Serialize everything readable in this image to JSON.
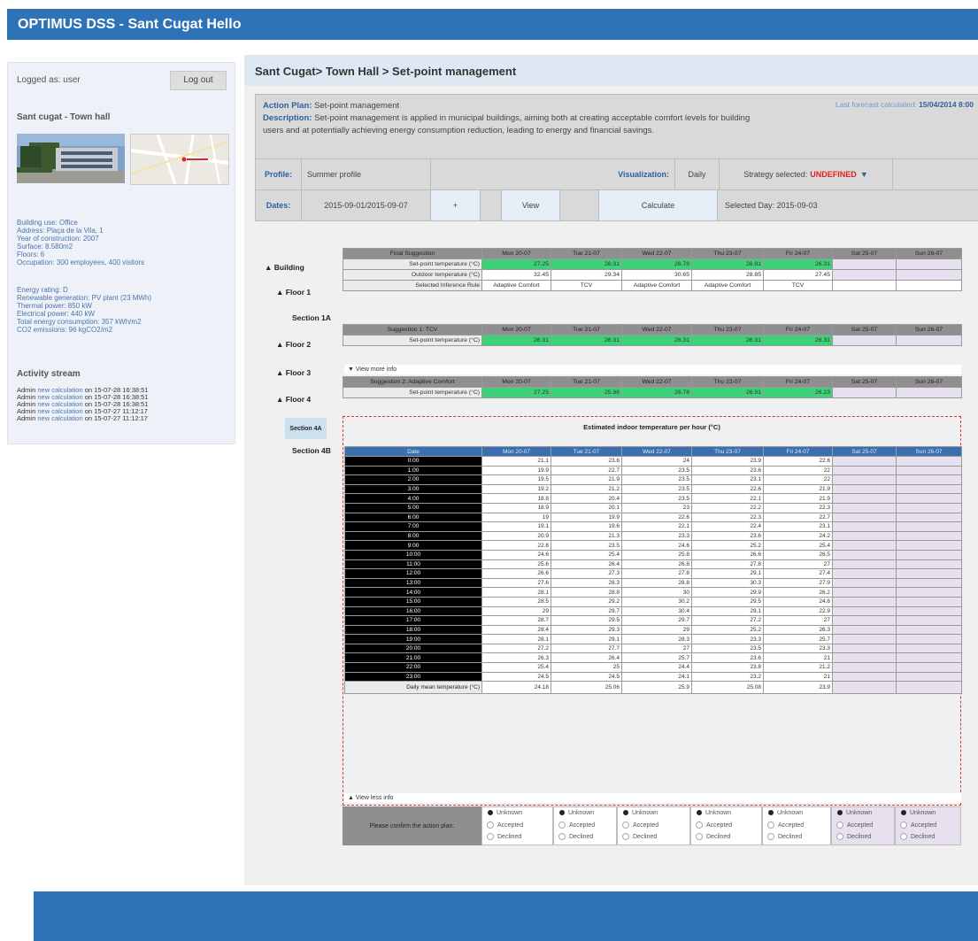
{
  "app": {
    "title": "OPTIMUS DSS - Sant Cugat Hello"
  },
  "sidebar": {
    "logged_as": "Logged as: user",
    "logout_label": "Log out",
    "building_name": "Sant cugat - Town hall",
    "info_lines": [
      "Building use: Office",
      "Address: Plaça de la Vila, 1",
      "Year of construction: 2007",
      "Surface: 8.580m2",
      "Floors: 6",
      "Occupation: 300 employees, 400 visitors"
    ],
    "energy_lines": [
      "Energy rating: D",
      "Renewable generation: PV plant (23 MWh)",
      "Thermal power: 850 kW",
      "Electrical power: 440 kW",
      "Total energy consumption: 357 kWh/m2",
      "CO2 emissions: 96 kgCO2/m2"
    ],
    "activity_title": "Activity stream",
    "activity": [
      {
        "user": "Admin",
        "link": "new calculation",
        "on": "on",
        "ts": "15-07-28 16:38:51"
      },
      {
        "user": "Admin",
        "link": "new calculation",
        "on": "on",
        "ts": "15-07-28 16:38:51"
      },
      {
        "user": "Admin",
        "link": "new calculation",
        "on": "on",
        "ts": "15-07-28 16:38:51"
      },
      {
        "user": "Admin",
        "link": "new calculation",
        "on": "on",
        "ts": "15-07-27 11:12:17"
      },
      {
        "user": "Admin",
        "link": "new calculation",
        "on": "on",
        "ts": "15-07-27 11:12:17"
      }
    ]
  },
  "main": {
    "breadcrumb": "Sant Cugat> Town Hall > Set-point management",
    "action_plan_label": "Action Plan:",
    "action_plan_value": "Set-point management",
    "description_label": "Description:",
    "description_text": "Set-point management is applied in municipal buildings, aiming both at creating acceptable comfort levels for building users and at potentially achieving energy consumption reduction, leading to energy and financial savings.",
    "forecast_label": "Last forecast calculated:",
    "forecast_value": "15/04/2014 8:00",
    "profile_label": "Profile:",
    "profile_value": "Summer profile",
    "visualization_label": "Visualization:",
    "visualization_value": "Daily",
    "strategy_label": "Strategy selected:",
    "strategy_value": "UNDEFINED",
    "dates_label": "Dates:",
    "dates_value": "2015-09-01/2015-09-07",
    "plus_label": "+",
    "view_label": "View",
    "calculate_label": "Calculate",
    "selected_day": "Selected Day: 2015-09-03"
  },
  "tree": {
    "building": "Building",
    "floor1": "Floor 1",
    "section1a": "Section 1A",
    "floor2": "Floor 2",
    "floor3": "Floor 3",
    "floor4": "Floor 4",
    "section4a": "Section 4A",
    "section4b": "Section 4B"
  },
  "days": [
    "Mon 20-07",
    "Tue 21-07",
    "Wed 22-07",
    "Thu 23-07",
    "Fri 24-07",
    "Sat 25-07",
    "Sun 26-07"
  ],
  "final": {
    "caption": "Final Suggestion",
    "rows": [
      {
        "label": "Set-point temperature (°C)",
        "values": [
          "27.25",
          "26.31",
          "26.78",
          "26.91",
          "26.31",
          "",
          ""
        ],
        "style": "grn"
      },
      {
        "label": "Outdoor temperature (°C)",
        "values": [
          "32.45",
          "29.34",
          "30.65",
          "28.85",
          "27.45",
          "",
          ""
        ],
        "style": "wht"
      },
      {
        "label": "Selected Inference Rule",
        "values": [
          "Adaptive Comfort",
          "TCV",
          "Adaptive Comfort",
          "Adaptive Comfort",
          "TCV",
          "",
          ""
        ],
        "style": "rule"
      }
    ]
  },
  "sugg1": {
    "caption": "Suggestion 1: TCV",
    "rows": [
      {
        "label": "Set-point temperature (°C)",
        "values": [
          "26.31",
          "26.31",
          "26.31",
          "26.31",
          "26.31",
          "",
          ""
        ],
        "style": "grn"
      }
    ]
  },
  "view_more": "View more info",
  "sugg2": {
    "caption": "Suggestion 2: Adaptive Comfort",
    "rows": [
      {
        "label": "Set-point temperature (°C)",
        "values": [
          "27.25",
          "25.96",
          "26.78",
          "26.91",
          "26.23",
          "",
          ""
        ],
        "style": "grn"
      }
    ]
  },
  "hourly": {
    "title": "Estimated indoor temperature per hour (°C)",
    "date_header": "Date",
    "hours": [
      "0:00",
      "1:00",
      "2:00",
      "3:00",
      "4:00",
      "5:00",
      "6:00",
      "7:00",
      "8:00",
      "9:00",
      "10:00",
      "11:00",
      "12:00",
      "13:00",
      "14:00",
      "15:00",
      "16:00",
      "17:00",
      "18:00",
      "19:00",
      "20:00",
      "21:00",
      "22:00",
      "23:00"
    ],
    "values": [
      [
        "21.1",
        "23.6",
        "24",
        "23.9",
        "22.6"
      ],
      [
        "19.9",
        "22.7",
        "23.5",
        "23.6",
        "22"
      ],
      [
        "19.5",
        "21.9",
        "23.5",
        "23.1",
        "22"
      ],
      [
        "19.2",
        "21.2",
        "23.5",
        "22.6",
        "21.9"
      ],
      [
        "18.8",
        "20.4",
        "23.5",
        "22.1",
        "21.9"
      ],
      [
        "18.9",
        "20.1",
        "23",
        "22.2",
        "22.3"
      ],
      [
        "19",
        "19.9",
        "22.6",
        "22.3",
        "22.7"
      ],
      [
        "19.1",
        "19.6",
        "22.1",
        "22.4",
        "23.1"
      ],
      [
        "20.9",
        "21.3",
        "23.3",
        "23.6",
        "24.2"
      ],
      [
        "22.8",
        "23.5",
        "24.6",
        "25.2",
        "25.4"
      ],
      [
        "24.6",
        "25.4",
        "25.8",
        "26.6",
        "26.5"
      ],
      [
        "25.6",
        "26.4",
        "26.8",
        "27.8",
        "27"
      ],
      [
        "26.6",
        "27.3",
        "27.8",
        "29.1",
        "27.4"
      ],
      [
        "27.6",
        "28.3",
        "28.8",
        "30.3",
        "27.9"
      ],
      [
        "28.1",
        "28.8",
        "30",
        "29.9",
        "26.2"
      ],
      [
        "28.5",
        "29.2",
        "30.2",
        "29.5",
        "24.6"
      ],
      [
        "29",
        "29.7",
        "30.4",
        "29.1",
        "22.9"
      ],
      [
        "28.7",
        "29.5",
        "29.7",
        "27.2",
        "27"
      ],
      [
        "28.4",
        "29.3",
        "29",
        "25.2",
        "26.3"
      ],
      [
        "28.1",
        "29.1",
        "28.3",
        "23.3",
        "25.7"
      ],
      [
        "27.2",
        "27.7",
        "27",
        "23.5",
        "23.3"
      ],
      [
        "26.3",
        "26.4",
        "25.7",
        "23.6",
        "21"
      ],
      [
        "25.4",
        "25",
        "24.4",
        "23.8",
        "21.2"
      ],
      [
        "24.5",
        "24.5",
        "24.1",
        "23.2",
        "21"
      ]
    ],
    "mean_label": "Daily mean temperature (°C)",
    "mean_values": [
      "24.18",
      "25.06",
      "25.9",
      "25.08",
      "23.9"
    ]
  },
  "view_less": "View less info",
  "confirm": {
    "label": "Please confirm the action plan:",
    "options": [
      "Unknown",
      "Accepted",
      "Declined"
    ]
  }
}
